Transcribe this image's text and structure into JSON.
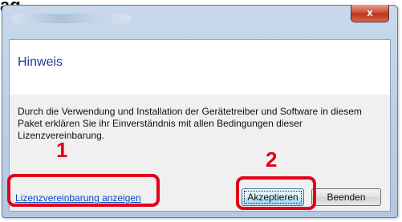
{
  "header": {
    "cropped_text": "ag"
  },
  "window": {
    "close_label": "x"
  },
  "dialog": {
    "heading": "Hinweis",
    "body": "Durch die Verwendung und Installation der Gerätetreiber und Software in diesem Paket erklären Sie ihr Einverständnis mit allen Bedingungen dieser Lizenzvereinbarung.",
    "license_link": "Lizenzvereinbarung anzeigen",
    "accept_button": "Akzeptieren",
    "quit_button": "Beenden"
  },
  "callouts": [
    {
      "number": "1"
    },
    {
      "number": "2"
    }
  ],
  "colors": {
    "callout": "#e3001b",
    "heading": "#1e3d8f",
    "link": "#0645c6",
    "close_button": "#c8452f"
  }
}
